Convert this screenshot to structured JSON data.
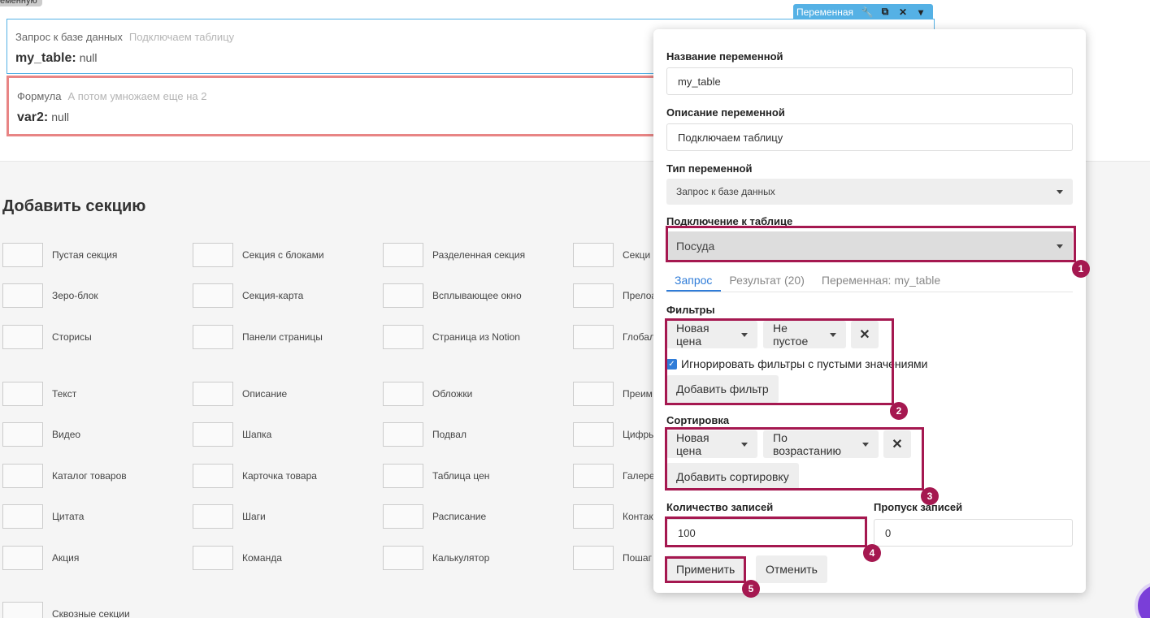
{
  "corner_tag": "еменную",
  "toolbar": {
    "label": "Переменная"
  },
  "blocks": [
    {
      "type": "Запрос к базе данных",
      "desc": "Подключаем таблицу",
      "var": "my_table",
      "value": "null"
    },
    {
      "type": "Формула",
      "desc": "А потом умножаем еще на 2",
      "var": "var2",
      "value": "null"
    }
  ],
  "add_section": {
    "title": "Добавить секцию",
    "items": [
      "Пустая секция",
      "Секция с блоками",
      "Разделенная секция",
      "Секци",
      "Зеро-блок",
      "Секция-карта",
      "Всплывающее окно",
      "Прелоа",
      "Сторисы",
      "Панели страницы",
      "Страница из Notion",
      "Глобал",
      "Текст",
      "Описание",
      "Обложки",
      "Преим",
      "Видео",
      "Шапка",
      "Подвал",
      "Цифры",
      "Каталог товаров",
      "Карточка товара",
      "Таблица цен",
      "Галере",
      "Цитата",
      "Шаги",
      "Расписание",
      "Контак",
      "Акция",
      "Команда",
      "Калькулятор",
      "Пошаг",
      "Сквозные секции"
    ]
  },
  "panel": {
    "name_label": "Название переменной",
    "name_value": "my_table",
    "desc_label": "Описание переменной",
    "desc_value": "Подключаем таблицу",
    "type_label": "Тип переменной",
    "type_value": "Запрос к базе данных",
    "conn_label": "Подключение к таблице",
    "conn_value": "Посуда",
    "tabs": [
      "Запрос",
      "Результат (20)",
      "Переменная: my_table"
    ],
    "filters_label": "Фильтры",
    "filter_field": "Новая цена",
    "filter_op": "Не пустое",
    "ignore_label": "Игнорировать фильтры с пустыми значениями",
    "add_filter": "Добавить фильтр",
    "sort_label": "Сортировка",
    "sort_field": "Новая цена",
    "sort_dir": "По возрастанию",
    "add_sort": "Добавить сортировку",
    "count_label": "Количество записей",
    "count_value": "100",
    "skip_label": "Пропуск записей",
    "skip_value": "0",
    "apply": "Применить",
    "cancel": "Отменить"
  },
  "markers": [
    "1",
    "2",
    "3",
    "4",
    "5"
  ]
}
